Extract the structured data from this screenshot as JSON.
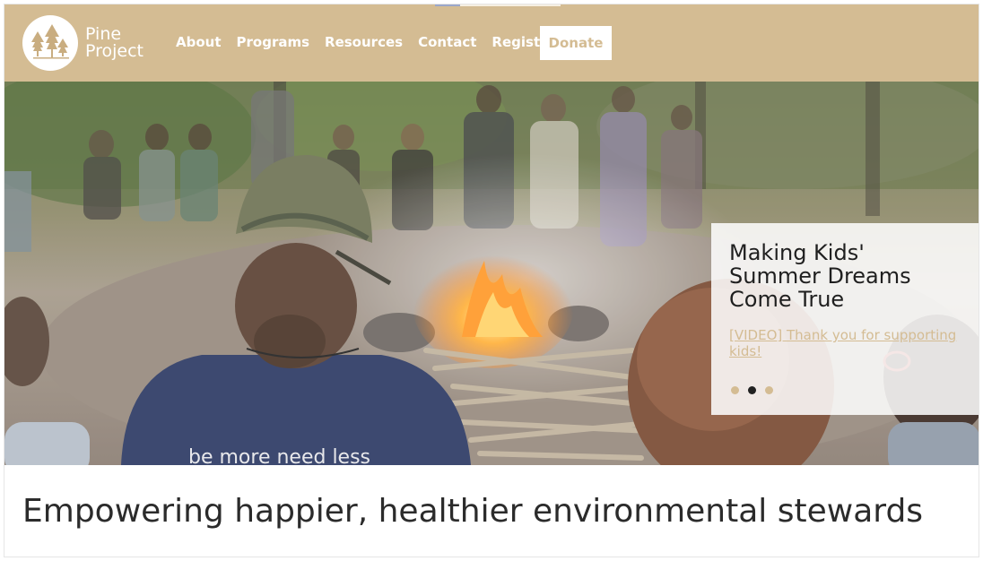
{
  "site": {
    "logo_line1": "Pine",
    "logo_line2": "Project"
  },
  "nav": {
    "items": [
      "About",
      "Programs",
      "Resources",
      "Contact",
      "Register"
    ],
    "donate_label": "Donate"
  },
  "slider": {
    "title": "Making Kids' Summer Dreams Come True",
    "link_text": "[VIDEO] Thank you for supporting kids!",
    "dots_count": 3,
    "active_dot": 2
  },
  "hero": {
    "shirt_text": "be more need less"
  },
  "tagline": "Empowering happier, healthier environmental stewards",
  "colors": {
    "brand": "#d4bc93",
    "text": "#2b2b2b",
    "white": "#ffffff"
  }
}
